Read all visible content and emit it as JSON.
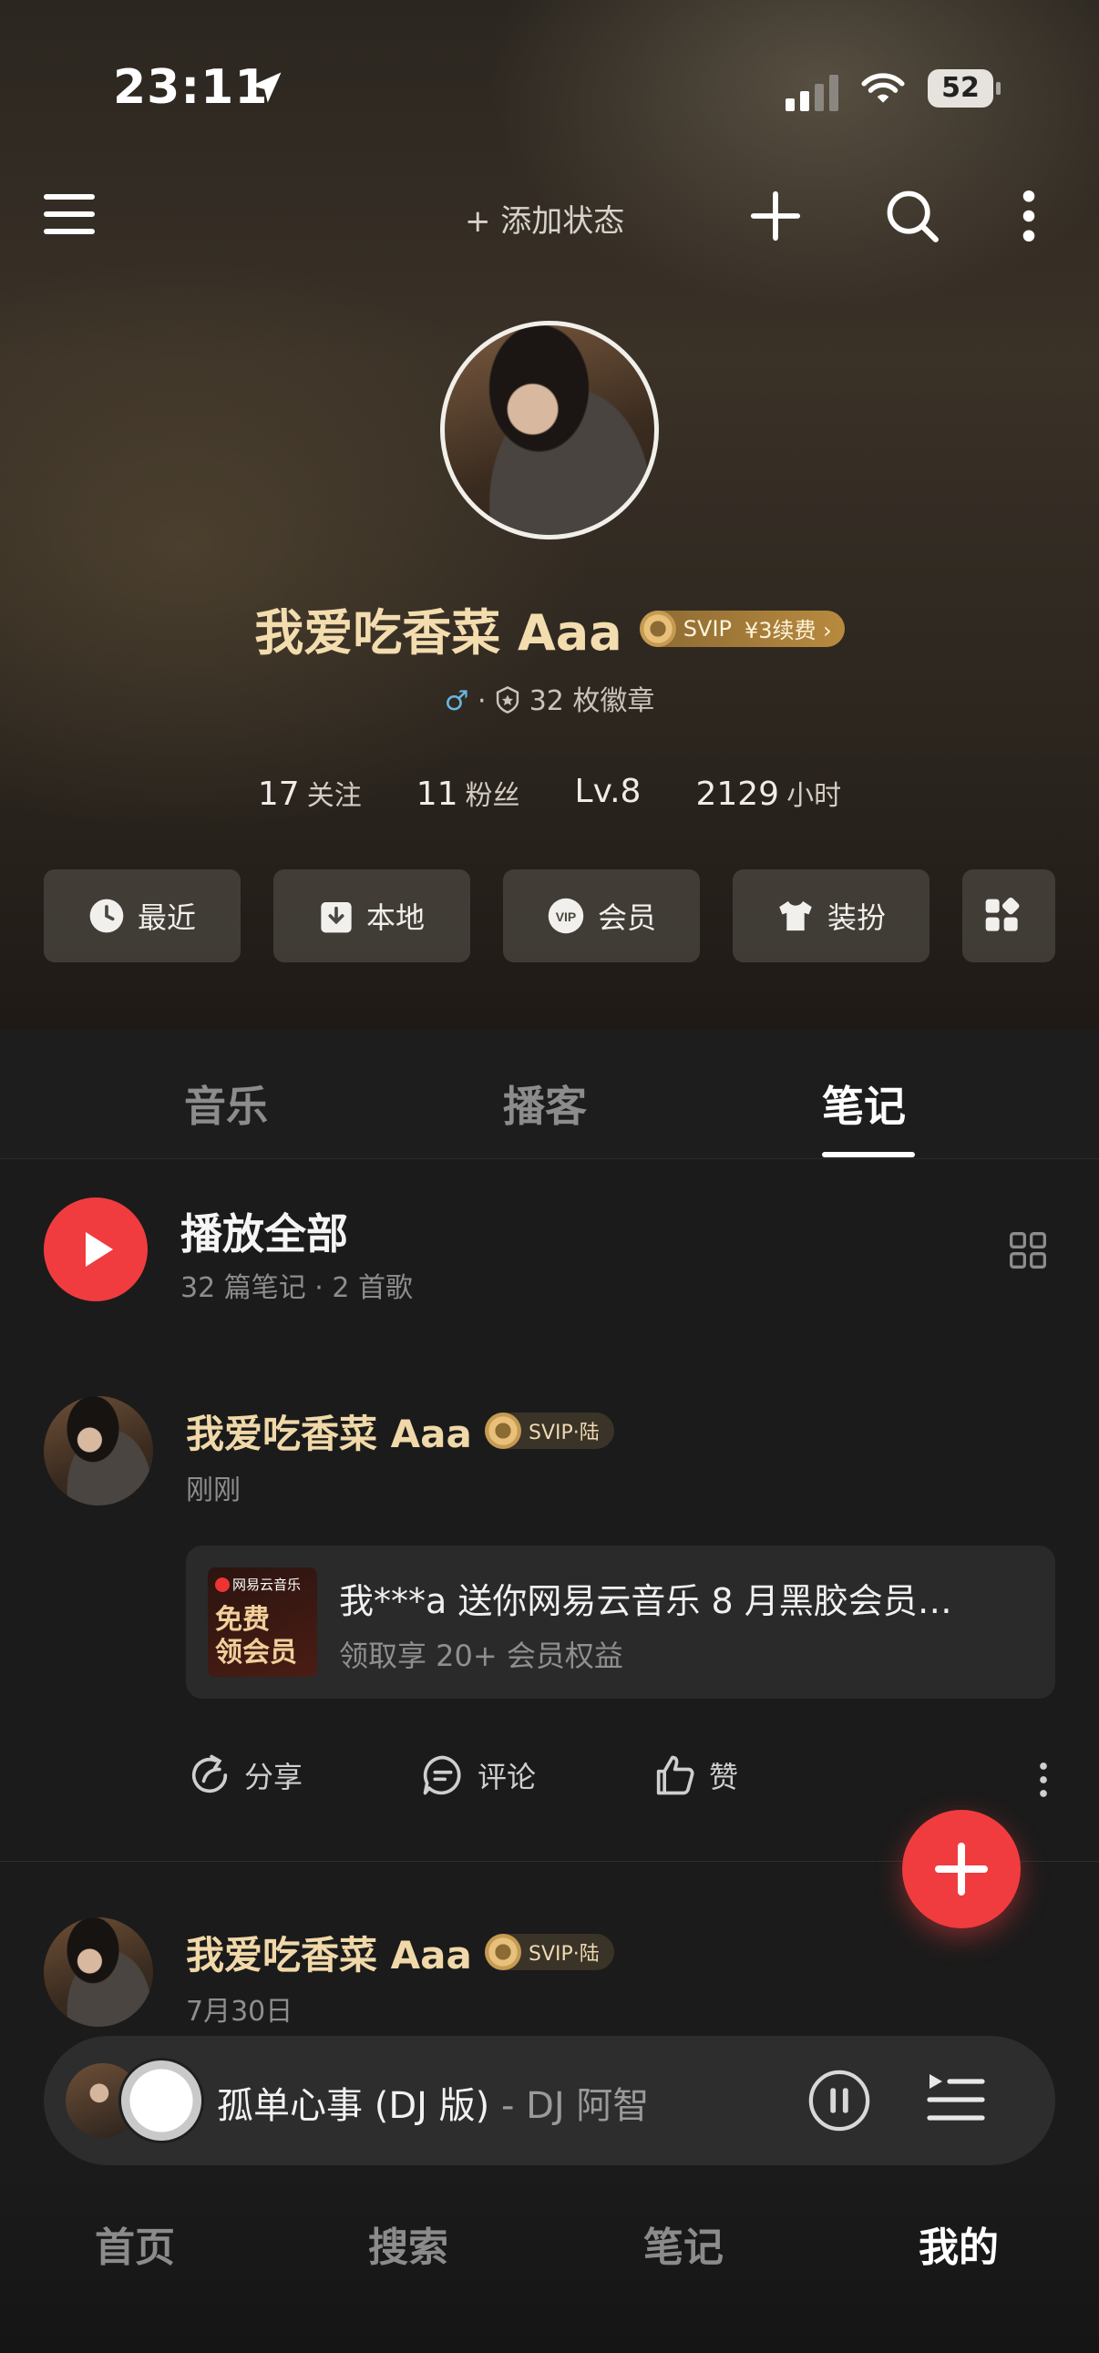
{
  "status_bar": {
    "time": "23:11",
    "battery": "52"
  },
  "top_bar": {
    "add_status": "+ 添加状态"
  },
  "profile": {
    "name": "我爱吃香菜 Aaa",
    "svip_label": "SVIP",
    "renew_label": "¥3续费 ›",
    "gender": "♂",
    "dot": "·",
    "badges": "32 枚徽章",
    "stats": {
      "follow_count": "17",
      "follow_label": "关注",
      "fans_count": "11",
      "fans_label": "粉丝",
      "level": "Lv.8",
      "hours_count": "2129",
      "hours_label": "小时"
    }
  },
  "quick_buttons": {
    "recent": "最近",
    "local": "本地",
    "vip": "会员",
    "dressup": "装扮"
  },
  "tabs": {
    "music": "音乐",
    "podcast": "播客",
    "notes": "笔记"
  },
  "play_all": {
    "title": "播放全部",
    "subtitle": "32 篇笔记 · 2 首歌"
  },
  "posts": [
    {
      "author": "我爱吃香菜 Aaa",
      "badge": "SVIP·陆",
      "time": "刚刚",
      "card": {
        "brand": "网易云音乐",
        "thumb_line1": "免费",
        "thumb_line2": "领会员",
        "title": "我***a 送你网易云音乐 8 月黑胶会员…",
        "subtitle": "领取享 20+ 会员权益"
      },
      "actions": {
        "share": "分享",
        "comment": "评论",
        "like": "赞"
      }
    },
    {
      "author": "我爱吃香菜 Aaa",
      "badge": "SVIP·陆",
      "time": "7月30日"
    }
  ],
  "player": {
    "song": "孤单心事 (DJ 版)",
    "artist": " - DJ 阿智"
  },
  "bottom_nav": {
    "home": "首页",
    "search": "搜索",
    "notes": "笔记",
    "mine": "我的"
  },
  "colors": {
    "accent_red": "#f03c3f",
    "gold_text": "#f3dcae"
  }
}
